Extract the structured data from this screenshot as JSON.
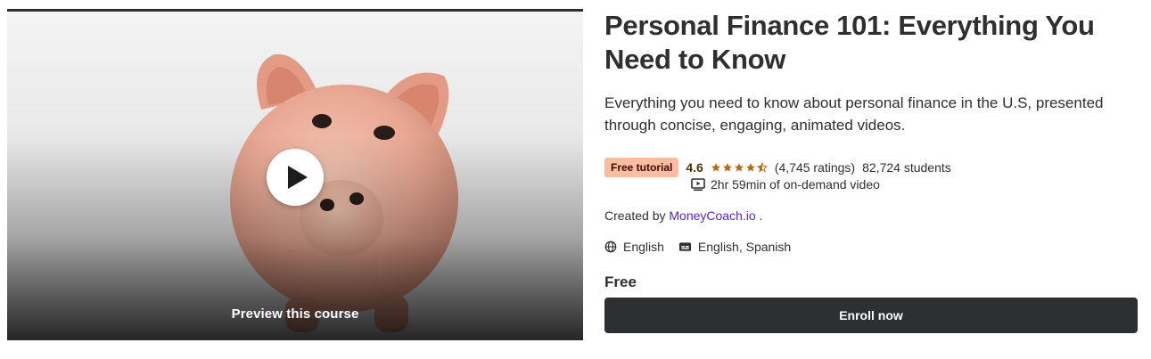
{
  "preview": {
    "label": "Preview this course",
    "play_icon": "play-icon"
  },
  "course": {
    "title": "Personal Finance 101: Everything You Need to Know",
    "subtitle": "Everything you need to know about personal finance in the U.S, presented through concise, engaging, animated videos.",
    "badge": "Free tutorial",
    "rating": "4.6",
    "rating_value": 4.6,
    "ratings_count": "(4,745 ratings)",
    "students": "82,724 students",
    "video_length": "2hr 59min of on-demand video",
    "created_by_label": "Created by",
    "instructor": "MoneyCoach.io",
    "instructor_suffix": ".",
    "language": "English",
    "captions": "English, Spanish",
    "price": "Free",
    "enroll_label": "Enroll now"
  },
  "colors": {
    "accent_link": "#5624d0",
    "badge_bg": "#fcbca0",
    "star": "#b4690e",
    "button_bg": "#2d2f31"
  }
}
